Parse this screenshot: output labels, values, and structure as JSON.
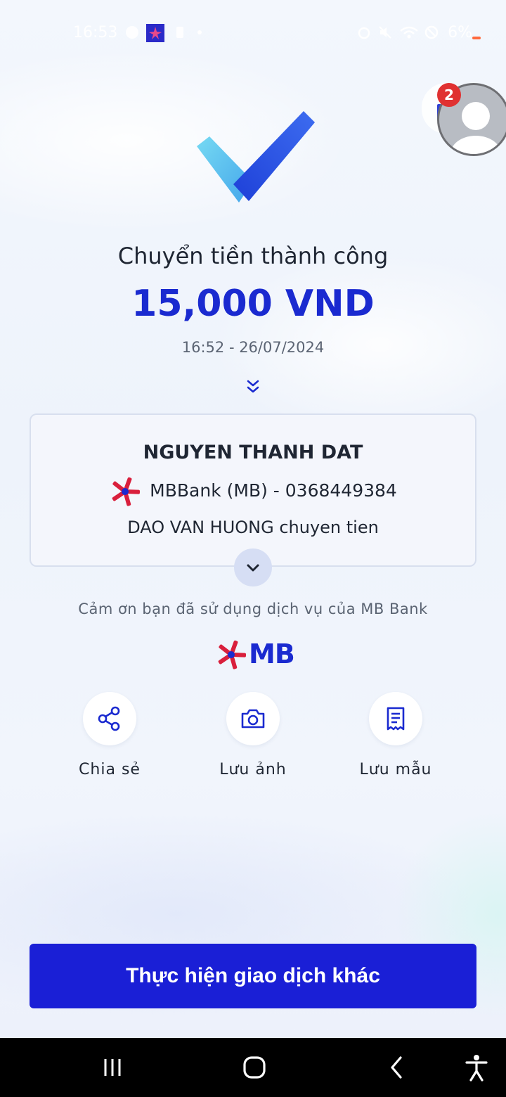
{
  "status_bar": {
    "time": "16:53",
    "battery": "6%"
  },
  "chat_bubble": {
    "badge_count": "2"
  },
  "result": {
    "title": "Chuyển tiền thành công",
    "amount": "15,000 VND",
    "datetime": "16:52 - 26/07/2024"
  },
  "recipient": {
    "name": "NGUYEN THANH DAT",
    "bank_account": "MBBank (MB) - 0368449384",
    "memo": "DAO VAN HUONG chuyen tien"
  },
  "thanks_text": "Cảm ơn bạn đã sử dụng dịch vụ của MB Bank",
  "logo_text": "MB",
  "actions": [
    {
      "label": "Chia sẻ",
      "icon": "share-icon"
    },
    {
      "label": "Lưu ảnh",
      "icon": "camera-icon"
    },
    {
      "label": "Lưu mẫu",
      "icon": "receipt-icon"
    }
  ],
  "primary_button": "Thực hiện giao dịch khác",
  "colors": {
    "brand_blue": "#1a2ad0",
    "button_blue": "#1a1fd6",
    "brand_red": "#d91f3c",
    "badge_red": "#e03131"
  }
}
